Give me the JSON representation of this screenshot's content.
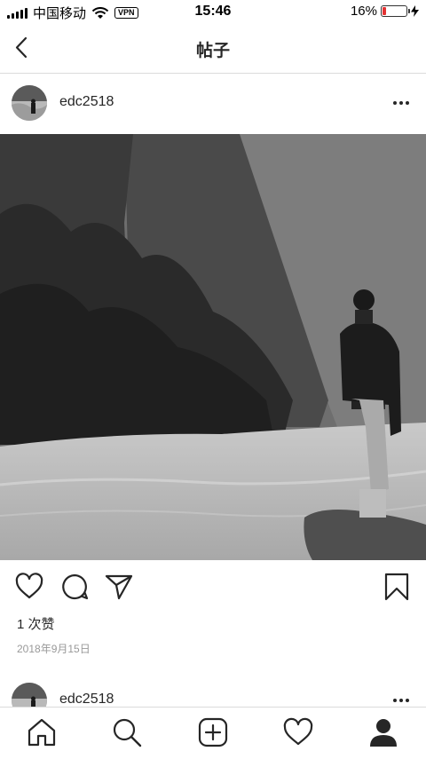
{
  "status_bar": {
    "carrier": "中国移动",
    "vpn": "VPN",
    "time": "15:46",
    "battery_percent": "16%",
    "battery_level": 0.16,
    "battery_color": "#e33333",
    "icons": [
      "signal-icon",
      "wifi-icon",
      "battery-icon",
      "charging-bolt-icon"
    ]
  },
  "navbar": {
    "title": "帖子",
    "back_icon": "chevron-left-icon"
  },
  "post": {
    "username": "edc2518",
    "avatar_icon": "avatar",
    "more_icon": "more-horizontal-icon",
    "image_description_icon": "post-photo",
    "likes": "1 次赞",
    "date": "2018年9月15日",
    "action_icons": [
      "heart-icon",
      "comment-icon",
      "share-icon",
      "bookmark-icon"
    ]
  },
  "next_post": {
    "username": "edc2518"
  },
  "tab_bar": {
    "items": [
      "home-icon",
      "search-icon",
      "add-post-icon",
      "activity-heart-icon",
      "profile-icon"
    ]
  }
}
